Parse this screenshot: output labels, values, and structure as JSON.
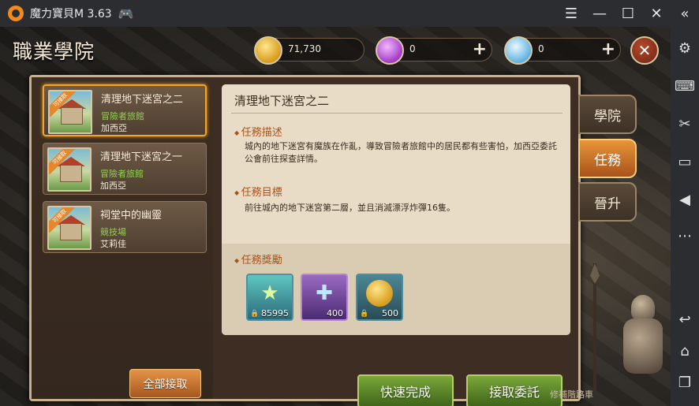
{
  "window": {
    "title": "魔力寶貝M 3.63",
    "controls": [
      "hamburger-icon",
      "minimize-icon",
      "maximize-icon",
      "close-icon",
      "collapse-icon"
    ]
  },
  "sidebar_icons": [
    "gear-icon",
    "keyboard-icon",
    "scissors-icon",
    "video-icon",
    "volume-icon",
    "more-icon",
    "back-icon",
    "home-icon",
    "recent-apps-icon"
  ],
  "game": {
    "page_title": "職業學院",
    "currencies": [
      {
        "icon": "gold-coin-icon",
        "value": "71,730",
        "has_plus": false
      },
      {
        "icon": "purple-gem-icon",
        "value": "0",
        "has_plus": true
      },
      {
        "icon": "diamond-icon",
        "value": "0",
        "has_plus": true
      }
    ],
    "quests": [
      {
        "name": "清理地下迷宮之二",
        "location": "冒險者旅館",
        "npc": "加西亞",
        "badge": "可接取",
        "active": true
      },
      {
        "name": "清理地下迷宮之一",
        "location": "冒險者旅館",
        "npc": "加西亞",
        "badge": "可接取",
        "active": false
      },
      {
        "name": "祠堂中的幽靈",
        "location": "競技場",
        "npc": "艾莉佳",
        "badge": "可接取",
        "active": false
      }
    ],
    "accept_all_label": "全部接取",
    "detail": {
      "title": "清理地下迷宮之二",
      "desc_heading": "任務描述",
      "desc_text": "城內的地下迷宮有魔族在作亂，導致冒險者旅館中的居民都有些害怕，加西亞委託公會前往探查詳情。",
      "goal_heading": "任務目標",
      "goal_text": "前往城內的地下迷宮第二層，並且消滅漂浮炸彈16隻。",
      "reward_heading": "任務獎勵",
      "rewards": [
        {
          "icon": "exp-star-icon",
          "count": "85995"
        },
        {
          "icon": "item-cross-icon",
          "count": "400"
        },
        {
          "icon": "gold-coin-icon",
          "count": "500"
        }
      ]
    },
    "buttons": {
      "quick_complete": "快速完成",
      "accept": "接取委託"
    },
    "tabs": [
      {
        "label": "學院",
        "active": false
      },
      {
        "label": "任務",
        "active": true
      },
      {
        "label": "晉升",
        "active": false
      }
    ],
    "footer_text": "修補階路車"
  }
}
